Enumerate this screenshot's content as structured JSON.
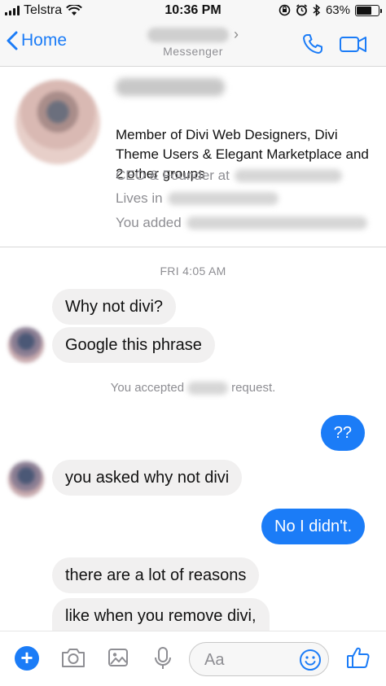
{
  "status_bar": {
    "carrier": "Telstra",
    "time": "10:36 PM",
    "battery_percent": "63%",
    "battery_level": 0.63
  },
  "nav": {
    "back_label": "Home",
    "subtitle": "Messenger"
  },
  "profile": {
    "groups_text": "Member of Divi Web Designers, Divi Theme Users & Elegant Marketplace and 2 other groups",
    "work_prefix": "CEO & Founder at",
    "lives_prefix": "Lives in",
    "added_prefix": "You added"
  },
  "chat": {
    "timestamp": "FRI 4:05 AM",
    "messages": [
      {
        "text": "Why not divi?"
      },
      {
        "text": "Google this phrase"
      },
      {
        "text": "??"
      },
      {
        "text": "you asked why not divi"
      },
      {
        "text": "No I didn't."
      },
      {
        "text": "there are a lot of reasons"
      },
      {
        "text": "like when you remove divi,"
      }
    ],
    "system_note_prefix": "You accepted",
    "system_note_suffix": "request."
  },
  "composer": {
    "placeholder": "Aa"
  },
  "colors": {
    "accent": "#1b7cf7",
    "incoming_bubble": "#f1f0f0",
    "secondary_text": "#8e8e93"
  },
  "icons": [
    "wifi-icon",
    "chevron-left-icon",
    "chevron-right-icon",
    "phone-icon",
    "video-camera-icon",
    "plus-icon",
    "camera-icon",
    "image-icon",
    "microphone-icon",
    "emoji-icon",
    "thumbs-up-icon"
  ]
}
